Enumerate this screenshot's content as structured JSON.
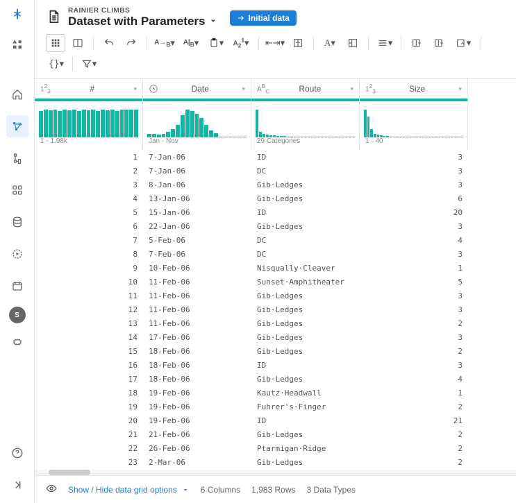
{
  "breadcrumb": "RAINIER CLIMBS",
  "title": "Dataset with Parameters",
  "pill": {
    "label": "Initial data",
    "icon": "arrow-right-icon"
  },
  "avatar": "S",
  "columns": [
    {
      "name": "#",
      "type": "123",
      "range": "1 - 1.98k",
      "histo": [
        38,
        40,
        39,
        40,
        38,
        40,
        39,
        40,
        38,
        40,
        39,
        40,
        38,
        40,
        39,
        40,
        38,
        40,
        40,
        40,
        40
      ]
    },
    {
      "name": "Date",
      "type": "clock",
      "range": "Jan - Nov",
      "histo": [
        5,
        5,
        4,
        5,
        8,
        12,
        18,
        32,
        40,
        38,
        34,
        28,
        18,
        10,
        6,
        1,
        0,
        0,
        0,
        0,
        0
      ]
    },
    {
      "name": "Route",
      "type": "abc",
      "range": "29 Categories",
      "histo": [
        40,
        8,
        5,
        4,
        3,
        3,
        2,
        2,
        2,
        1,
        1,
        1,
        1,
        1,
        1,
        1,
        1,
        1,
        1,
        1,
        1,
        1,
        1,
        1,
        1,
        1,
        1,
        1,
        1
      ]
    },
    {
      "name": "Size",
      "type": "123",
      "range": "1 - 40",
      "histo": [
        40,
        30,
        12,
        5,
        4,
        3,
        2,
        2,
        1,
        1,
        1,
        1,
        1,
        1,
        1,
        1,
        1,
        1,
        1,
        1,
        1,
        1,
        1,
        1,
        1,
        1,
        1,
        1,
        1,
        1,
        1
      ]
    }
  ],
  "rows": [
    {
      "n": 1,
      "date": "7-Jan-06",
      "route": "ID",
      "size": 3
    },
    {
      "n": 2,
      "date": "7-Jan-06",
      "route": "DC",
      "size": 3
    },
    {
      "n": 3,
      "date": "8-Jan-06",
      "route": "Gib·Ledges",
      "size": 3
    },
    {
      "n": 4,
      "date": "13-Jan-06",
      "route": "Gib·Ledges",
      "size": 6
    },
    {
      "n": 5,
      "date": "15-Jan-06",
      "route": "ID",
      "size": 20
    },
    {
      "n": 6,
      "date": "22-Jan-06",
      "route": "Gib·Ledges",
      "size": 3
    },
    {
      "n": 7,
      "date": "5-Feb-06",
      "route": "DC",
      "size": 4
    },
    {
      "n": 8,
      "date": "7-Feb-06",
      "route": "DC",
      "size": 3
    },
    {
      "n": 9,
      "date": "10-Feb-06",
      "route": "Nisqually·Cleaver",
      "size": 1
    },
    {
      "n": 10,
      "date": "11-Feb-06",
      "route": "Sunset·Amphitheater",
      "size": 5
    },
    {
      "n": 11,
      "date": "11-Feb-06",
      "route": "Gib·Ledges",
      "size": 3
    },
    {
      "n": 12,
      "date": "11-Feb-06",
      "route": "Gib·Ledges",
      "size": 3
    },
    {
      "n": 13,
      "date": "11-Feb-06",
      "route": "Gib·Ledges",
      "size": 2
    },
    {
      "n": 14,
      "date": "17-Feb-06",
      "route": "Gib·Ledges",
      "size": 3
    },
    {
      "n": 15,
      "date": "18-Feb-06",
      "route": "Gib·Ledges",
      "size": 2
    },
    {
      "n": 16,
      "date": "18-Feb-06",
      "route": "ID",
      "size": 3
    },
    {
      "n": 17,
      "date": "18-Feb-06",
      "route": "Gib·Ledges",
      "size": 4
    },
    {
      "n": 18,
      "date": "19-Feb-06",
      "route": "Kautz·Headwall",
      "size": 1
    },
    {
      "n": 19,
      "date": "19-Feb-06",
      "route": "Fuhrer's·Finger",
      "size": 2
    },
    {
      "n": 20,
      "date": "19-Feb-06",
      "route": "ID",
      "size": 21
    },
    {
      "n": 21,
      "date": "21-Feb-06",
      "route": "Gib·Ledges",
      "size": 2
    },
    {
      "n": 22,
      "date": "26-Feb-06",
      "route": "Ptarmigan·Ridge",
      "size": 2
    },
    {
      "n": 23,
      "date": "2-Mar-06",
      "route": "Gib·Ledges",
      "size": 2
    }
  ],
  "footer": {
    "toggle": "Show / Hide data grid options",
    "cols": "6 Columns",
    "rows": "1,983 Rows",
    "types": "3 Data Types"
  }
}
